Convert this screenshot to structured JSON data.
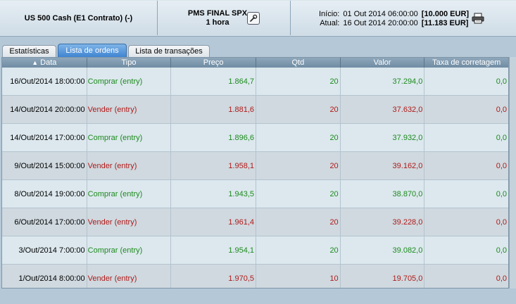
{
  "header": {
    "instrument": "US 500 Cash (E1 Contrato) (-)",
    "strategy_name": "PMS FINAL SPX",
    "timeframe": "1 hora",
    "start_label": "Início:",
    "start_date": "01 Out 2014 06:00:00",
    "start_amount": "[10.000 EUR]",
    "current_label": "Atual:",
    "current_date": "16 Out 2014 20:00:00",
    "current_amount": "[11.183 EUR]",
    "settings_icon": "wrench-icon",
    "print_icon": "printer-icon"
  },
  "tabs": [
    {
      "label": "Estatísticas",
      "active": false
    },
    {
      "label": "Lista de ordens",
      "active": true
    },
    {
      "label": "Lista de transações",
      "active": false
    }
  ],
  "table": {
    "columns": [
      "Data",
      "Tipo",
      "Preço",
      "Qtd",
      "Valor",
      "Taxa de corretagem"
    ],
    "sort_column": "Data",
    "rows": [
      {
        "date": "16/Out/2014 18:00:00",
        "type": "Comprar (entry)",
        "price": "1.864,7",
        "qty": "20",
        "value": "37.294,0",
        "fee": "0,0",
        "side": "buy"
      },
      {
        "date": "14/Out/2014 20:00:00",
        "type": "Vender (entry)",
        "price": "1.881,6",
        "qty": "20",
        "value": "37.632,0",
        "fee": "0,0",
        "side": "sell"
      },
      {
        "date": "14/Out/2014 17:00:00",
        "type": "Comprar (entry)",
        "price": "1.896,6",
        "qty": "20",
        "value": "37.932,0",
        "fee": "0,0",
        "side": "buy"
      },
      {
        "date": "9/Out/2014 15:00:00",
        "type": "Vender (entry)",
        "price": "1.958,1",
        "qty": "20",
        "value": "39.162,0",
        "fee": "0,0",
        "side": "sell"
      },
      {
        "date": "8/Out/2014 19:00:00",
        "type": "Comprar (entry)",
        "price": "1.943,5",
        "qty": "20",
        "value": "38.870,0",
        "fee": "0,0",
        "side": "buy"
      },
      {
        "date": "6/Out/2014 17:00:00",
        "type": "Vender (entry)",
        "price": "1.961,4",
        "qty": "20",
        "value": "39.228,0",
        "fee": "0,0",
        "side": "sell"
      },
      {
        "date": "3/Out/2014 7:00:00",
        "type": "Comprar (entry)",
        "price": "1.954,1",
        "qty": "20",
        "value": "39.082,0",
        "fee": "0,0",
        "side": "buy"
      },
      {
        "date": "1/Out/2014 8:00:00",
        "type": "Vender (entry)",
        "price": "1.970,5",
        "qty": "10",
        "value": "19.705,0",
        "fee": "0,0",
        "side": "sell"
      }
    ]
  },
  "colors": {
    "buy": "#1e8a1e",
    "sell": "#b01a1a",
    "active_tab": "#3c82d0",
    "header_bg": "#d9e4ec"
  }
}
